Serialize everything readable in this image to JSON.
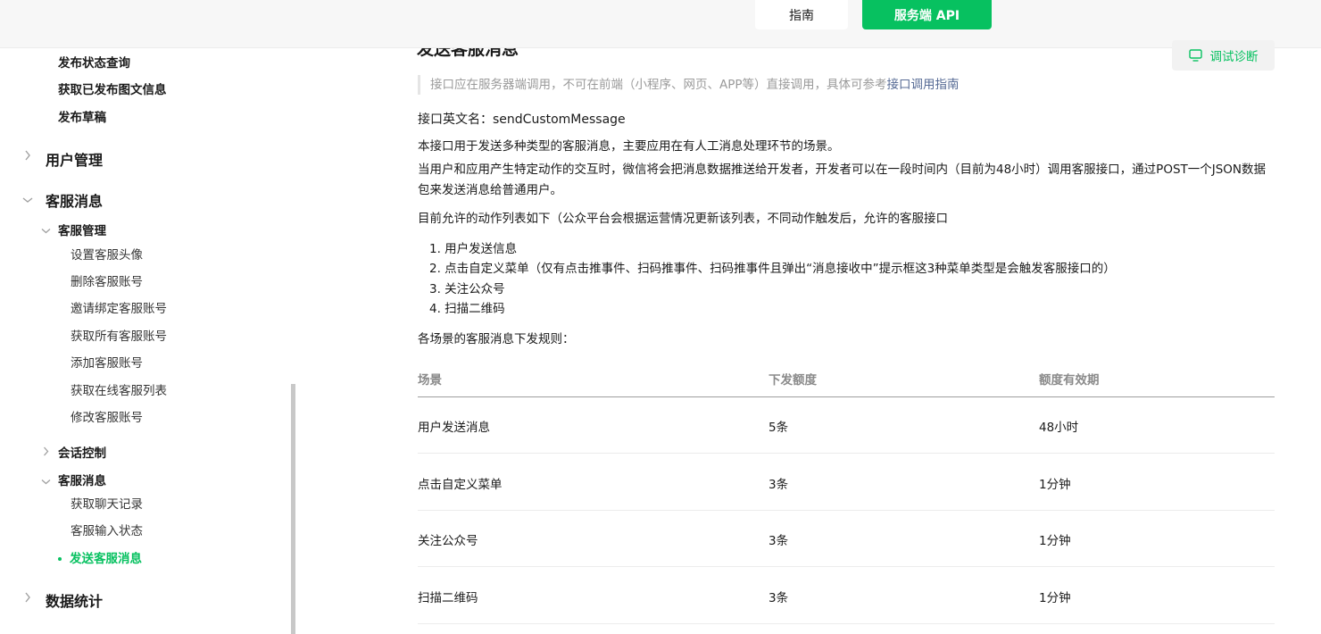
{
  "topbar": {
    "guide_label": "指南",
    "api_label": "服务端 API"
  },
  "sidebar": {
    "top_items": [
      "发布状态查询",
      "获取已发布图文信息",
      "发布草稿"
    ],
    "section_user": "用户管理",
    "section_kefu": "客服消息",
    "group_kefu_manage": "客服管理",
    "kefu_manage_items": [
      "设置客服头像",
      "删除客服账号",
      "邀请绑定客服账号",
      "获取所有客服账号",
      "添加客服账号",
      "获取在线客服列表",
      "修改客服账号"
    ],
    "group_session": "会话控制",
    "group_kefu_msg": "客服消息",
    "kefu_msg_items": [
      "获取聊天记录",
      "客服输入状态"
    ],
    "active_item": "发送客服消息",
    "section_stats": "数据统计"
  },
  "main": {
    "title": "发送客服消息",
    "debug_button": "调试诊断",
    "notice_text": "接口应在服务器端调用，不可在前端（小程序、网页、APP等）直接调用，具体可参考",
    "notice_link": "接口调用指南",
    "api_name": "接口英文名：sendCustomMessage",
    "desc1": "本接口用于发送多种类型的客服消息，主要应用在有人工消息处理环节的场景。",
    "desc2": "当用户和应用产生特定动作的交互时，微信将会把消息数据推送给开发者，开发者可以在一段时间内（目前为48小时）调用客服接口，通过POST一个JSON数据包来发送消息给普通用户。",
    "desc3": "目前允许的动作列表如下（公众平台会根据运营情况更新该列表，不同动作触发后，允许的客服接口",
    "actions": [
      "1. 用户发送信息",
      "2. 点击自定义菜单（仅有点击推事件、扫码推事件、扫码推事件且弹出“消息接收中”提示框这3种菜单类型是会触发客服接口的）",
      "3. 关注公众号",
      "4. 扫描二维码"
    ],
    "rules_title": "各场景的客服消息下发规则：",
    "table": {
      "headers": [
        "场景",
        "下发额度",
        "额度有效期"
      ],
      "rows": [
        [
          "用户发送消息",
          "5条",
          "48小时"
        ],
        [
          "点击自定义菜单",
          "3条",
          "1分钟"
        ],
        [
          "关注公众号",
          "3条",
          "1分钟"
        ],
        [
          "扫描二维码",
          "3条",
          "1分钟"
        ]
      ]
    }
  },
  "colors": {
    "accent": "#07c160",
    "link": "#576b95"
  }
}
